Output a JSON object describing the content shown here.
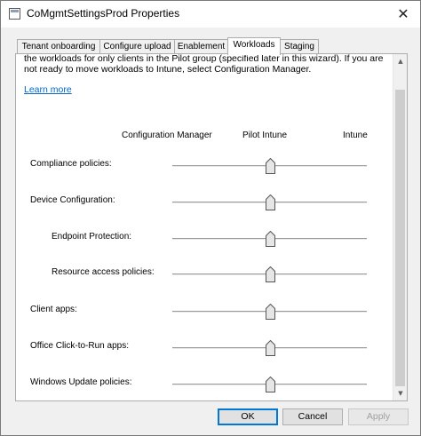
{
  "window": {
    "title": "CoMgmtSettingsProd Properties",
    "close_glyph": "✕"
  },
  "tabs": [
    {
      "label": "Tenant onboarding",
      "active": false
    },
    {
      "label": "Configure upload",
      "active": false
    },
    {
      "label": "Enablement",
      "active": false
    },
    {
      "label": "Workloads",
      "active": true
    },
    {
      "label": "Staging",
      "active": false
    }
  ],
  "workloads": {
    "intro_text": "the workloads for only clients in the Pilot group (specified later in this wizard). If you are not ready to move workloads to Intune, select Configuration Manager.",
    "learn_more": "Learn more",
    "columns": [
      "Configuration Manager",
      "Pilot Intune",
      "Intune"
    ],
    "items": [
      {
        "label": "Compliance policies:",
        "setting": "Pilot Intune",
        "position": 0.5
      },
      {
        "label": "Device Configuration:",
        "setting": "Pilot Intune",
        "position": 0.5
      },
      {
        "label": "Endpoint Protection:",
        "setting": "Pilot Intune",
        "position": 0.5
      },
      {
        "label": "Resource access policies:",
        "setting": "Pilot Intune",
        "position": 0.5
      },
      {
        "label": "Client apps:",
        "setting": "Pilot Intune",
        "position": 0.5
      },
      {
        "label": "Office Click-to-Run apps:",
        "setting": "Pilot Intune",
        "position": 0.5
      },
      {
        "label": "Windows Update policies:",
        "setting": "Pilot Intune",
        "position": 0.5
      }
    ]
  },
  "scrollbar": {
    "up_glyph": "▲",
    "down_glyph": "▼"
  },
  "buttons": {
    "ok": "OK",
    "cancel": "Cancel",
    "apply": "Apply"
  }
}
